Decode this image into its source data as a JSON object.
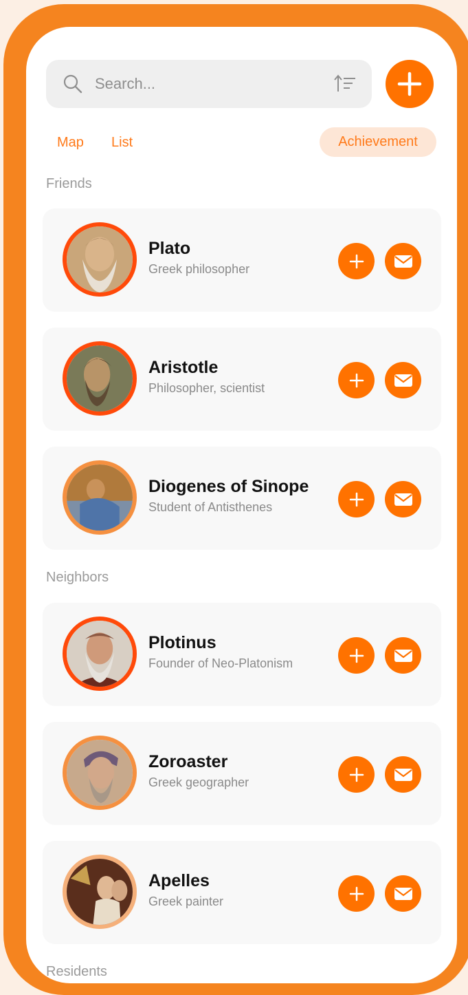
{
  "colors": {
    "accent": "#ff7200",
    "frame": "#f5841f",
    "card": "#f8f8f8"
  },
  "search": {
    "placeholder": "Search...",
    "icon": "search-icon",
    "sort_icon": "sort-icon"
  },
  "tabs": {
    "map": "Map",
    "list": "List",
    "achievement": "Achievement"
  },
  "sections": [
    {
      "title": "Friends",
      "people": [
        {
          "name": "Plato",
          "desc": "Greek philosopher"
        },
        {
          "name": "Aristotle",
          "desc": "Philosopher, scientist"
        },
        {
          "name": "Diogenes of Sinope",
          "desc": "Student of Antisthenes"
        }
      ]
    },
    {
      "title": "Neighbors",
      "people": [
        {
          "name": "Plotinus",
          "desc": "Founder of Neo-Platonism"
        },
        {
          "name": "Zoroaster",
          "desc": "Greek geographer"
        },
        {
          "name": "Apelles",
          "desc": "Greek painter"
        }
      ]
    },
    {
      "title": "Residents",
      "people": []
    }
  ]
}
